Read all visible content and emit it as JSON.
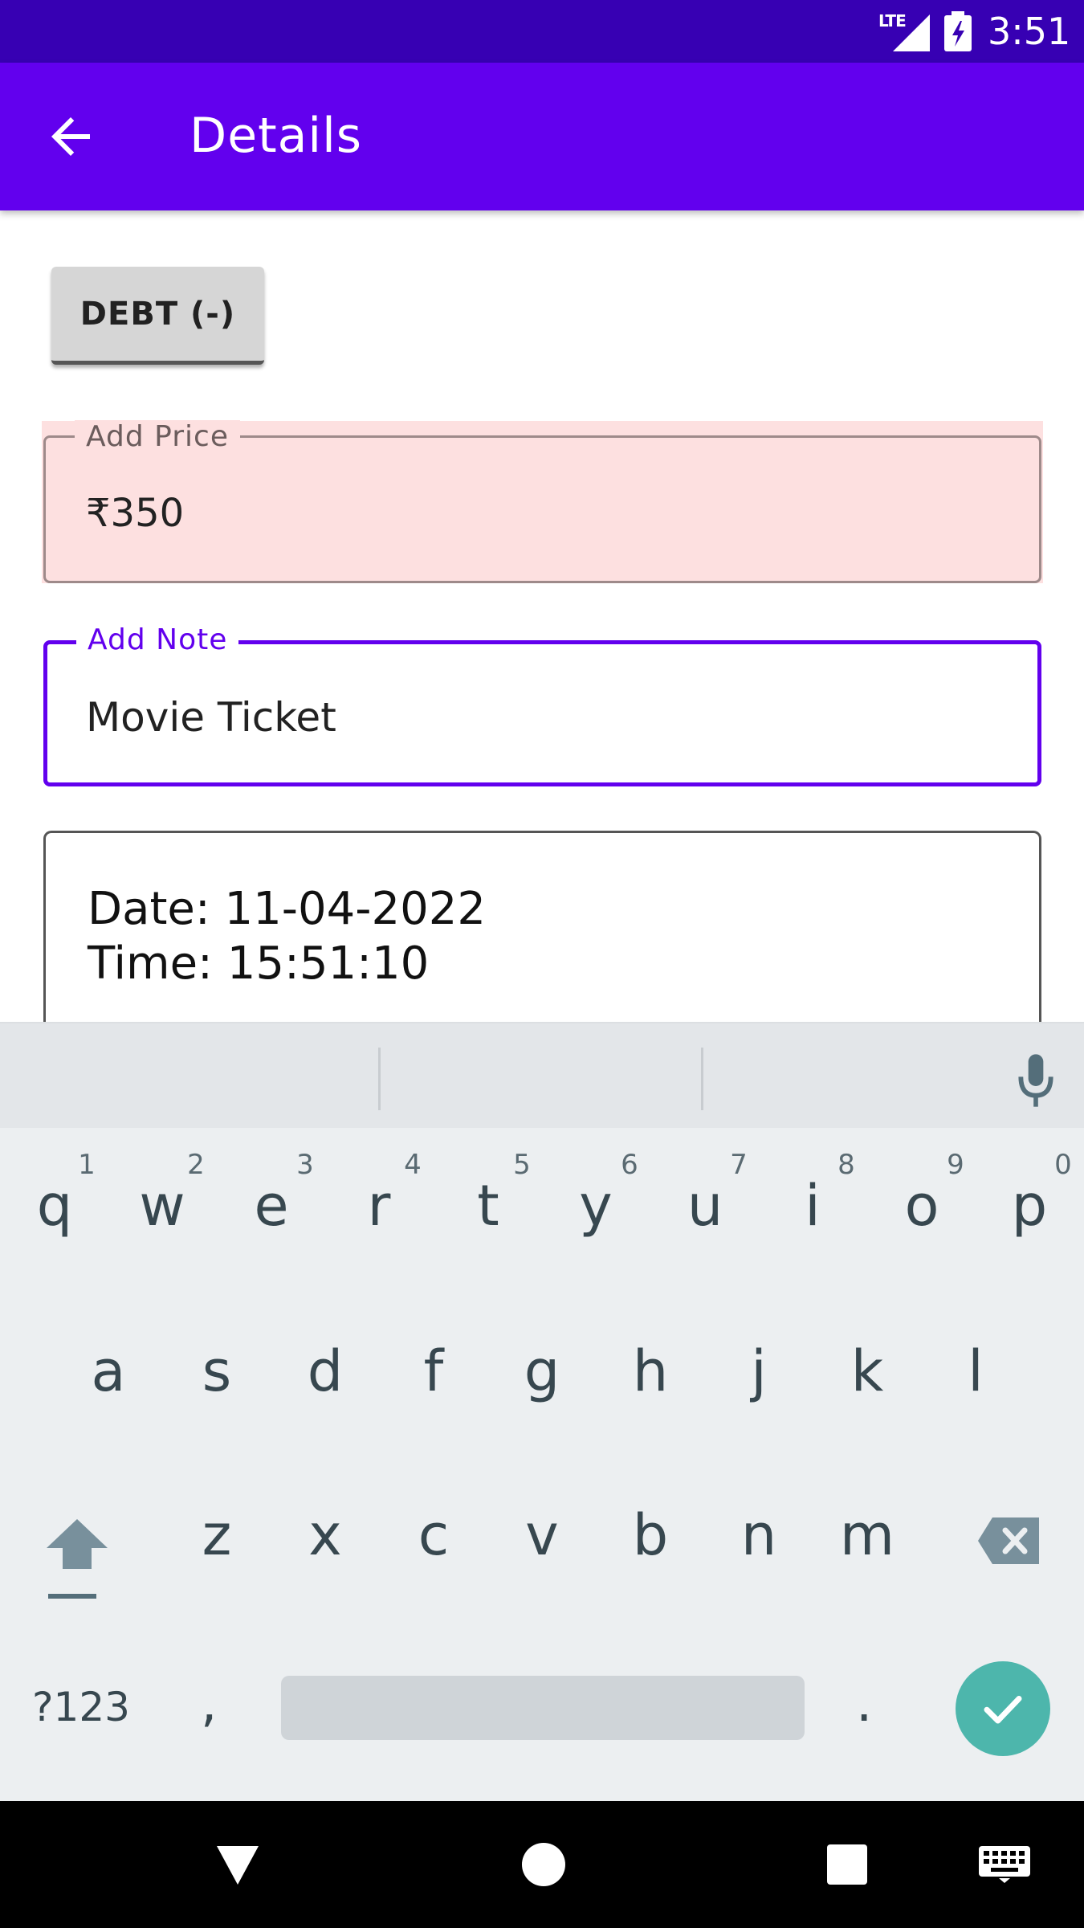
{
  "status_bar": {
    "network": "LTE",
    "time": "3:51"
  },
  "app_bar": {
    "title": "Details"
  },
  "debt_button": {
    "label": "DEBT (-)"
  },
  "price_field": {
    "label": "Add Price",
    "currency": "₹",
    "value": "350",
    "background_color": "#fde0e0"
  },
  "note_field": {
    "label": "Add Note",
    "value": "Movie Ticket",
    "accent_color": "#6200ee"
  },
  "datetime_field": {
    "date": "Date: 11-04-2022",
    "time": "Time: 15:51:10"
  },
  "keyboard": {
    "row1": [
      {
        "key": "q",
        "hint": "1"
      },
      {
        "key": "w",
        "hint": "2"
      },
      {
        "key": "e",
        "hint": "3"
      },
      {
        "key": "r",
        "hint": "4"
      },
      {
        "key": "t",
        "hint": "5"
      },
      {
        "key": "y",
        "hint": "6"
      },
      {
        "key": "u",
        "hint": "7"
      },
      {
        "key": "i",
        "hint": "8"
      },
      {
        "key": "o",
        "hint": "9"
      },
      {
        "key": "p",
        "hint": "0"
      }
    ],
    "row2": [
      "a",
      "s",
      "d",
      "f",
      "g",
      "h",
      "j",
      "k",
      "l"
    ],
    "row3": [
      "z",
      "x",
      "c",
      "v",
      "b",
      "n",
      "m"
    ],
    "symbols_label": "?123",
    "comma": ",",
    "period": ".",
    "enter_color": "#4db6ac"
  },
  "colors": {
    "status_bar": "#3700b3",
    "app_bar": "#6200ee"
  }
}
